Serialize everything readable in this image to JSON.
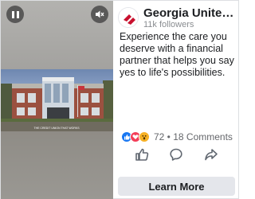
{
  "ad": {
    "video": {
      "pause_icon": "pause-icon",
      "mute_icon": "mute-icon",
      "photo_caption": "THE CREDIT UNION THAT WORKS"
    },
    "page": {
      "name": "Georgia United Credit Union",
      "followers": "11k followers",
      "logo_icon": "gucu-logo",
      "brand_color": "#c8102e"
    },
    "body_text": "Experience the care you deserve with a financial partner that helps you say yes to life's possibilities.",
    "engagement": {
      "reaction_icons": [
        "like-icon",
        "love-icon",
        "wow-icon"
      ],
      "stats": "72 • 18 Comments"
    },
    "actions": {
      "like_icon": "thumbs-up-icon",
      "comment_icon": "comment-icon",
      "share_icon": "share-icon"
    },
    "cta_label": "Learn More"
  }
}
